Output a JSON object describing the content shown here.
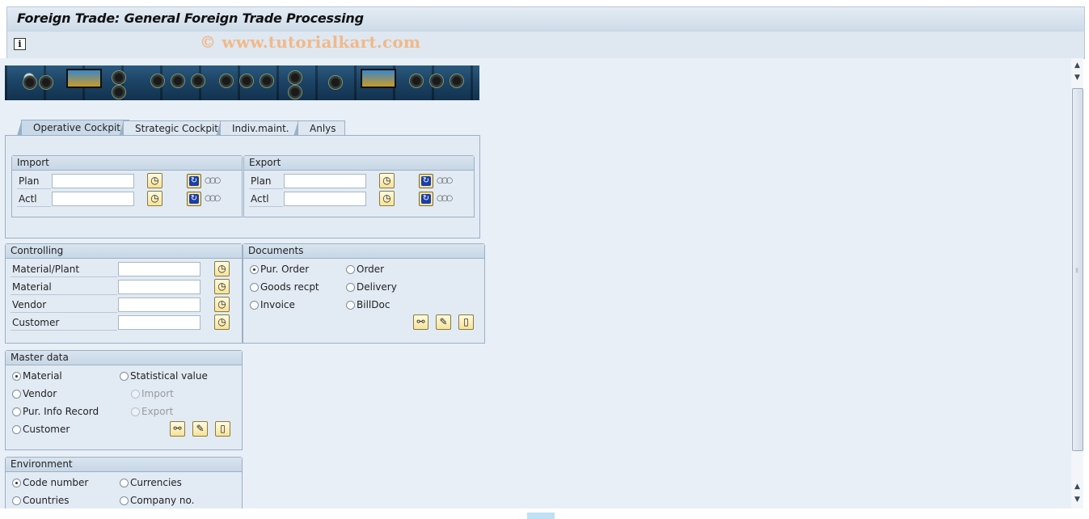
{
  "window": {
    "title": "Foreign Trade: General Foreign Trade Processing",
    "watermark": "© www.tutorialkart.com"
  },
  "toolbar": {
    "info_icon": "i"
  },
  "tabs": [
    {
      "label": "Operative Cockpit",
      "active": true
    },
    {
      "label": "Strategic Cockpit",
      "active": false
    },
    {
      "label": "Indiv.maint.",
      "active": false
    },
    {
      "label": "Anlys",
      "active": false
    }
  ],
  "import": {
    "title": "Import",
    "rows": [
      {
        "label": "Plan",
        "value": ""
      },
      {
        "label": "Actl",
        "value": ""
      }
    ]
  },
  "export": {
    "title": "Export",
    "rows": [
      {
        "label": "Plan",
        "value": ""
      },
      {
        "label": "Actl",
        "value": ""
      }
    ]
  },
  "controlling": {
    "title": "Controlling",
    "rows": [
      {
        "label": "Material/Plant",
        "value": ""
      },
      {
        "label": "Material",
        "value": ""
      },
      {
        "label": "Vendor",
        "value": ""
      },
      {
        "label": "Customer",
        "value": ""
      }
    ]
  },
  "documents": {
    "title": "Documents",
    "options": [
      {
        "label": "Pur. Order",
        "selected": true
      },
      {
        "label": "Order",
        "selected": false
      },
      {
        "label": "Goods recpt",
        "selected": false
      },
      {
        "label": "Delivery",
        "selected": false
      },
      {
        "label": "Invoice",
        "selected": false
      },
      {
        "label": "BillDoc",
        "selected": false
      }
    ]
  },
  "master_data": {
    "title": "Master data",
    "options": [
      {
        "label": "Material",
        "selected": true
      },
      {
        "label": "Statistical value",
        "selected": false
      },
      {
        "label": "Vendor",
        "selected": false
      },
      {
        "label": "Import",
        "selected": false,
        "disabled": true
      },
      {
        "label": "Pur. Info Record",
        "selected": false
      },
      {
        "label": "Export",
        "selected": false,
        "disabled": true
      },
      {
        "label": "Customer",
        "selected": false
      }
    ]
  },
  "environment": {
    "title": "Environment",
    "options": [
      {
        "label": "Code number",
        "selected": true
      },
      {
        "label": "Currencies",
        "selected": false
      },
      {
        "label": "Countries",
        "selected": false
      },
      {
        "label": "Company no.",
        "selected": false
      }
    ]
  },
  "icons": {
    "execute": "◷",
    "display": "⚯",
    "change": "✎",
    "create": "▯",
    "refresh": "↻",
    "lights": "○○○",
    "scroll_up": "▲",
    "scroll_down": "▼",
    "grip": "⁞⁞"
  }
}
